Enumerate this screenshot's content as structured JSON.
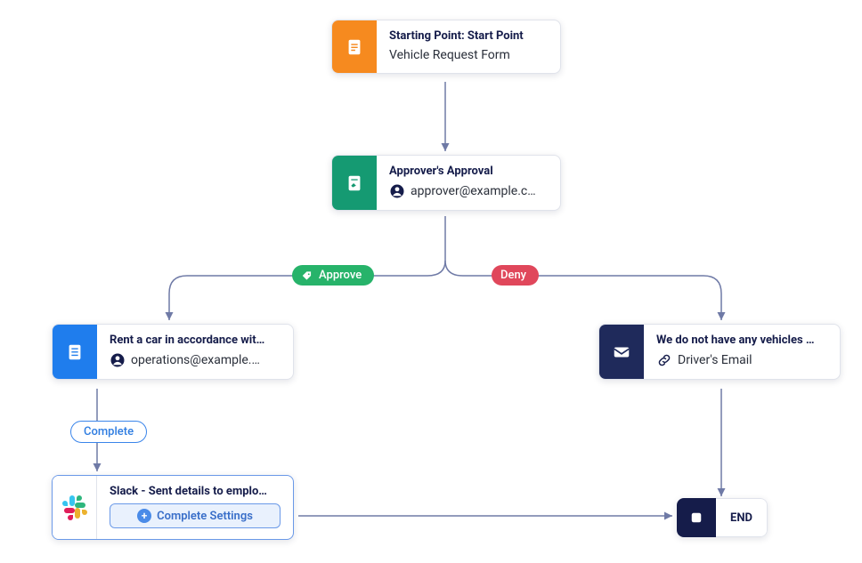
{
  "nodes": {
    "start": {
      "title": "Starting Point: Start Point",
      "subtitle": "Vehicle Request Form"
    },
    "approval": {
      "title": "Approver's Approval",
      "subtitle": "approver@example.c…"
    },
    "rent": {
      "title": "Rent a car in accordance wit…",
      "subtitle": "operations@example.…"
    },
    "reject": {
      "title": "We do not have any vehicles …",
      "subtitle": "Driver's Email"
    },
    "slack": {
      "title": "Slack - Sent details to emplo…",
      "button": "Complete Settings"
    },
    "end": {
      "label": "END"
    }
  },
  "badges": {
    "approve": "Approve",
    "deny": "Deny",
    "complete": "Complete"
  }
}
